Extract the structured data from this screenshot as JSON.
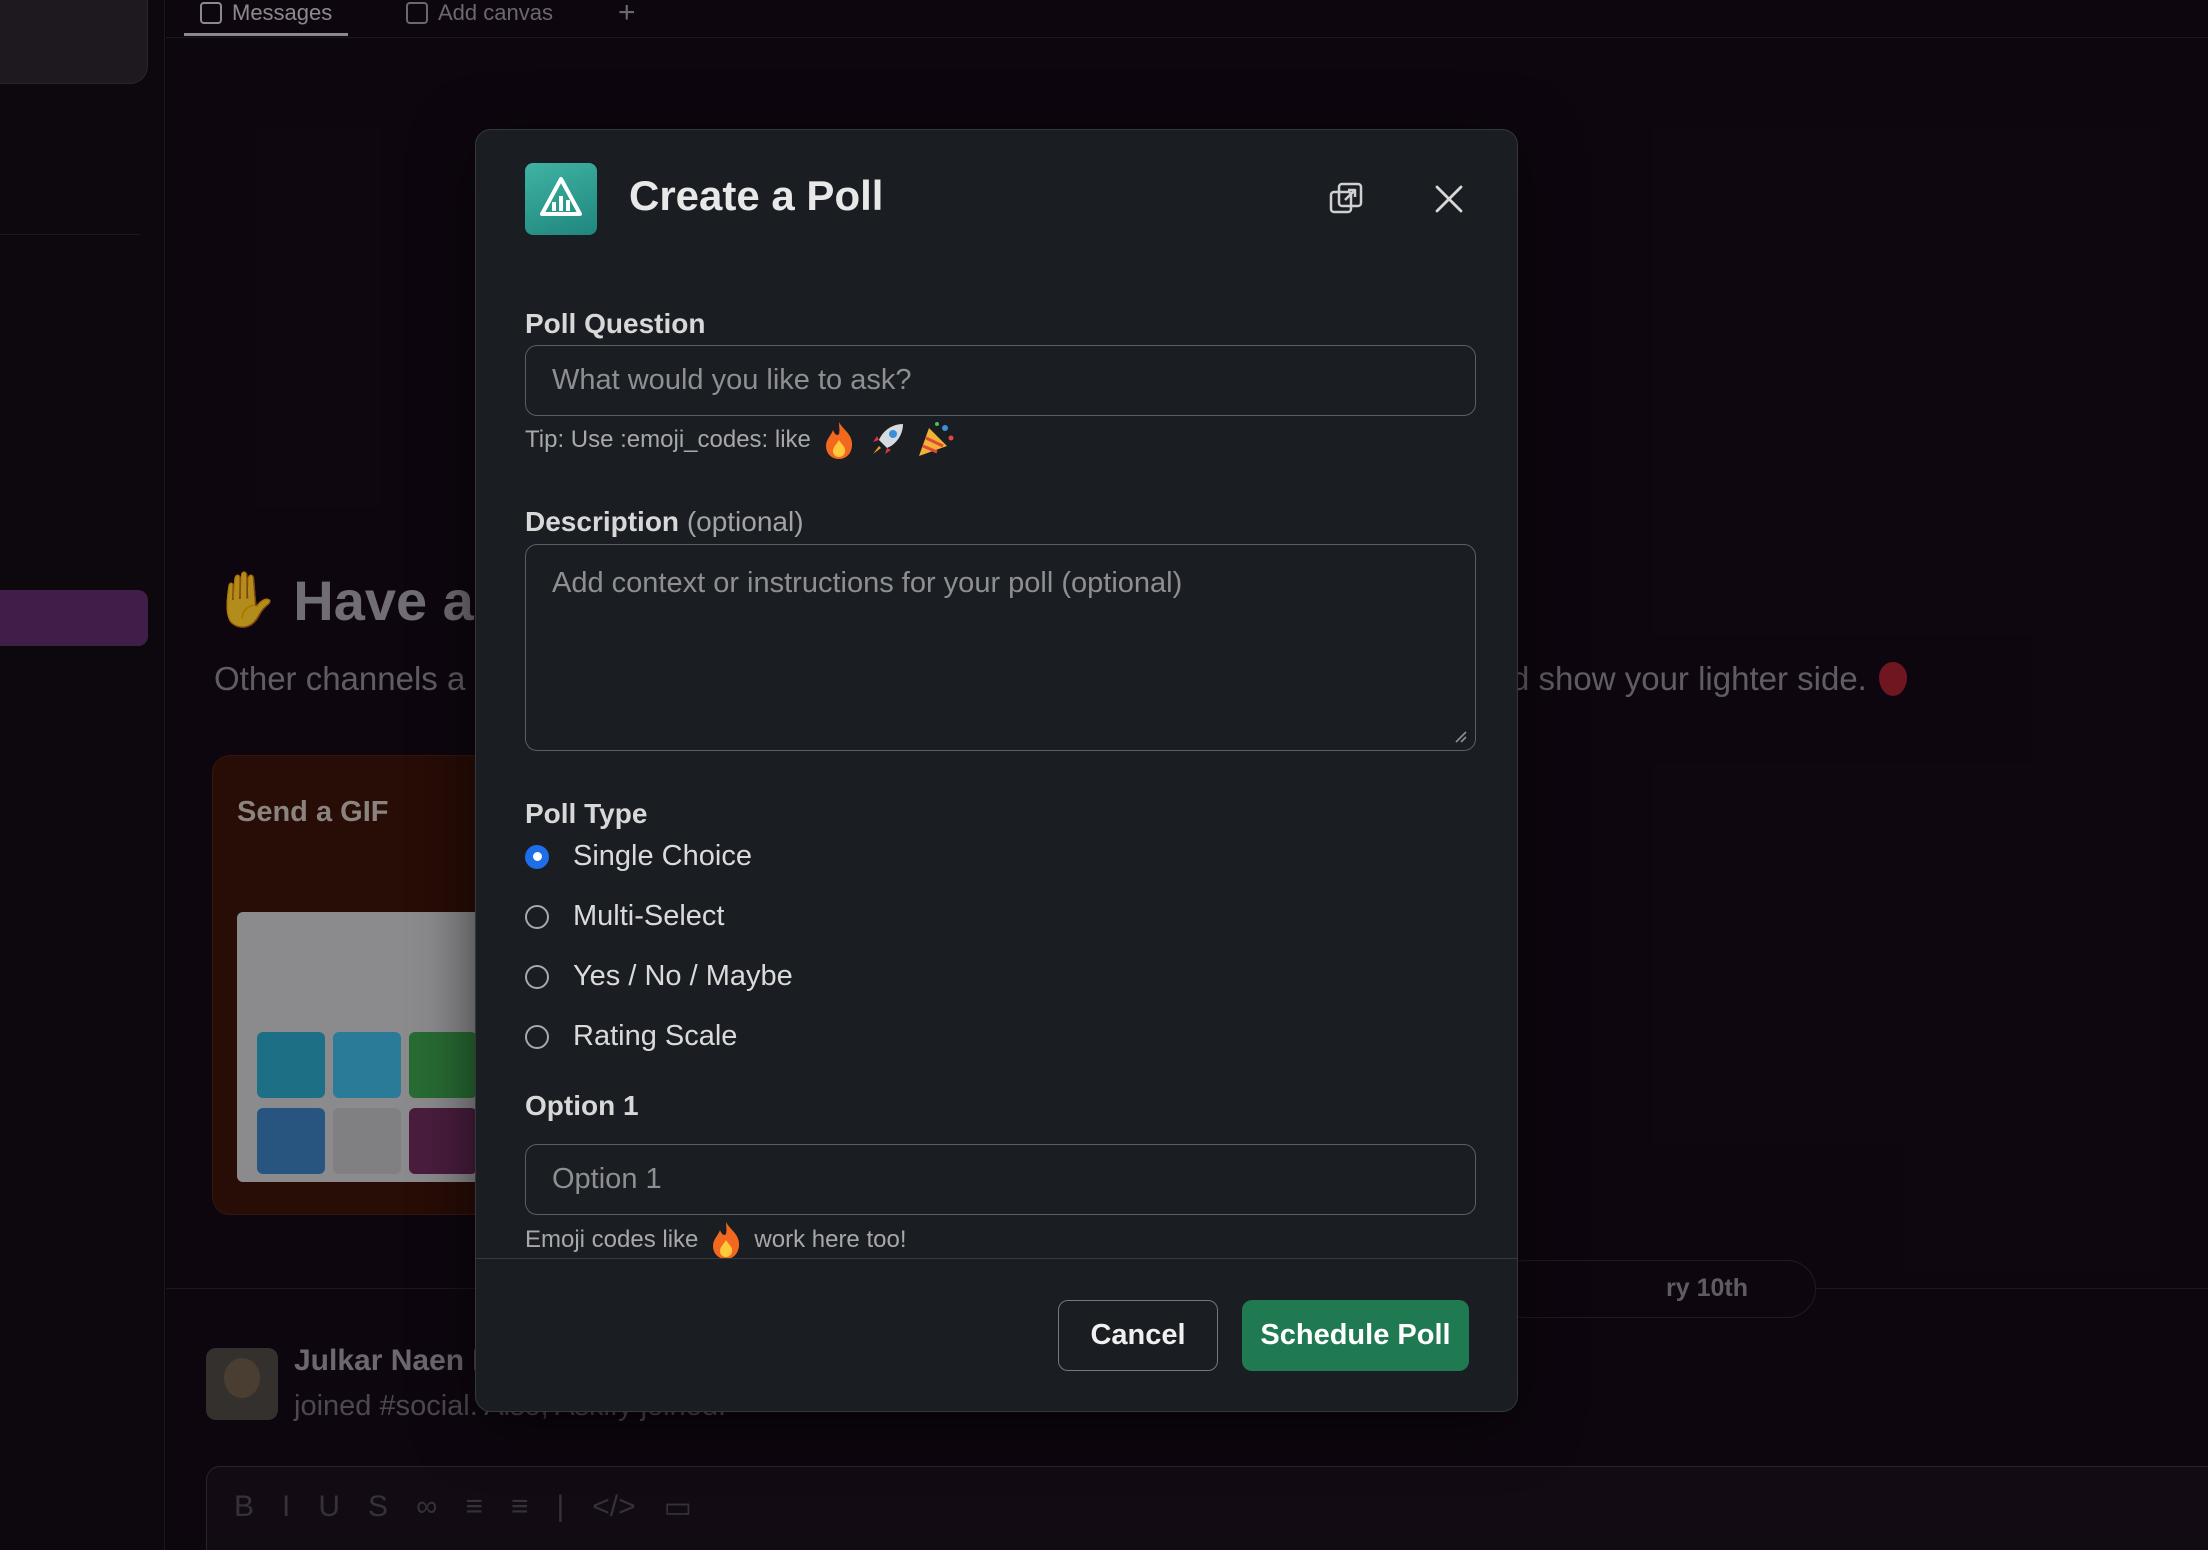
{
  "background": {
    "tabs": {
      "messages": "Messages",
      "add_canvas": "Add canvas",
      "plus": "+"
    },
    "welcome_title": "Have a",
    "welcome_sub_left": "Other channels a",
    "welcome_sub_right": "d show your lighter side.",
    "gif_card_title": "Send a GIF",
    "date_pill": "ry 10th",
    "message_author": "Julkar Naen N",
    "message_text": "joined #social. Also, Askify joined."
  },
  "modal": {
    "title": "Create a Poll",
    "poll_question": {
      "label": "Poll Question",
      "placeholder": "What would you like to ask?",
      "hint": "Tip: Use :emoji_codes: like"
    },
    "description": {
      "label": "Description",
      "optional": "(optional)",
      "placeholder": "Add context or instructions for your poll (optional)"
    },
    "poll_type": {
      "label": "Poll Type",
      "options": [
        "Single Choice",
        "Multi-Select",
        "Yes / No / Maybe",
        "Rating Scale"
      ],
      "selected": "Single Choice"
    },
    "option1": {
      "label": "Option 1",
      "placeholder": "Option 1",
      "hint_before": "Emoji codes like",
      "hint_after": "work here too!"
    },
    "buttons": {
      "cancel": "Cancel",
      "schedule": "Schedule Poll"
    }
  },
  "icons": [
    "app-icon",
    "popout-icon",
    "close-icon",
    "fire-emoji-icon",
    "rocket-emoji-icon",
    "party-popper-emoji-icon"
  ],
  "colors": {
    "accent_blue": "#1d6ee8",
    "schedule_green": "#1f7a52",
    "modal_bg": "#1a1d21"
  }
}
